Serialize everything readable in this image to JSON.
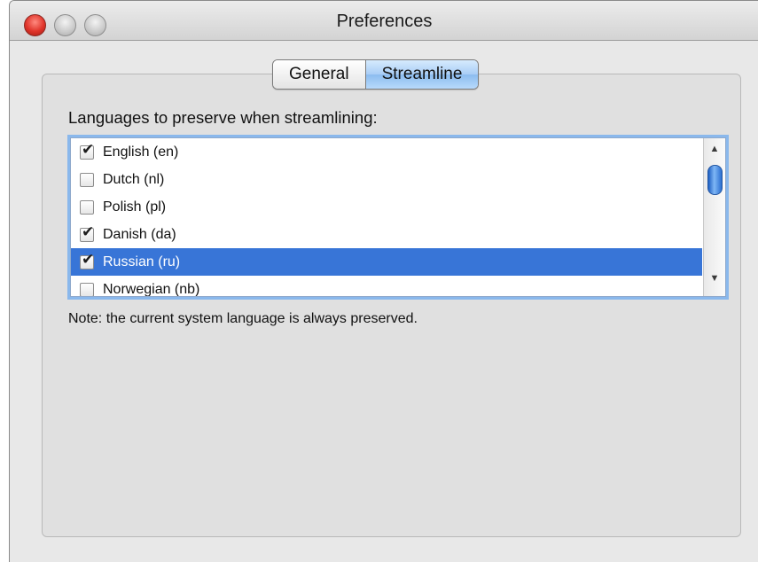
{
  "window": {
    "title": "Preferences"
  },
  "tabs": [
    {
      "label": "General",
      "selected": false
    },
    {
      "label": "Streamline",
      "selected": true
    }
  ],
  "streamline": {
    "section_label": "Languages to preserve when streamlining:",
    "languages": [
      {
        "label": "English (en)",
        "checked": true,
        "selected": false
      },
      {
        "label": "Dutch (nl)",
        "checked": false,
        "selected": false
      },
      {
        "label": "Polish (pl)",
        "checked": false,
        "selected": false
      },
      {
        "label": "Danish (da)",
        "checked": true,
        "selected": false
      },
      {
        "label": "Russian (ru)",
        "checked": true,
        "selected": true
      },
      {
        "label": "Norwegian (nb)",
        "checked": false,
        "selected": false
      }
    ],
    "note": "Note: the current system language is always preserved."
  },
  "icons": {
    "close": "close-icon",
    "minimize": "minimize-icon",
    "zoom": "zoom-icon",
    "scroll_up": "arrow-up-icon",
    "scroll_down": "arrow-down-icon",
    "checkmark": "checkmark-icon"
  },
  "colors": {
    "selection": "#3875d7",
    "active_tab": "#a9cdf6",
    "close_button": "#e0342a",
    "focus_ring": "#8ab8ec"
  }
}
